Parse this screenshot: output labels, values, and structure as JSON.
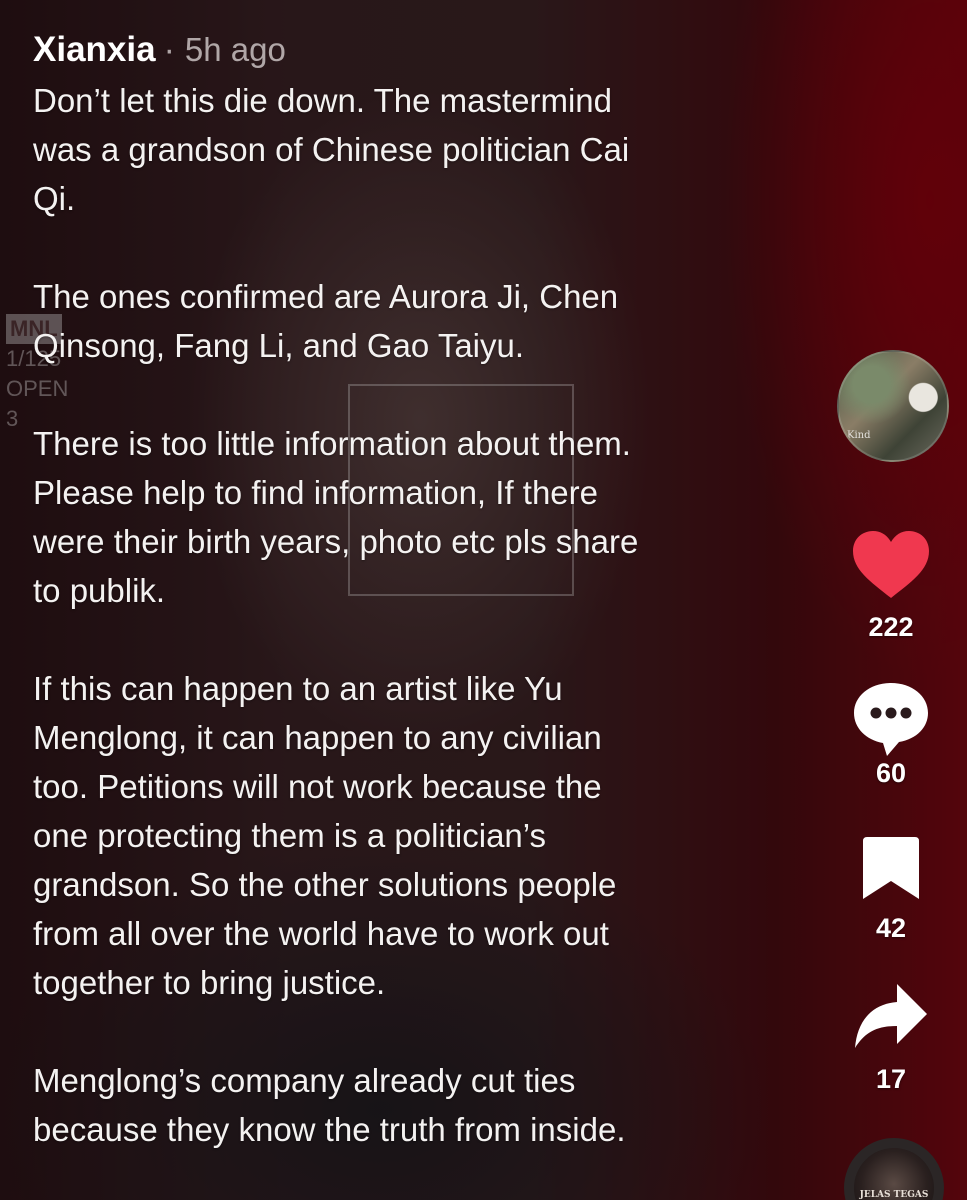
{
  "comment": {
    "username": "Xianxia",
    "separator": "·",
    "time": "5h ago",
    "paragraphs": [
      "Don’t let this die down. The mastermind\nwas a grandson of Chinese politician Cai\nQi.",
      "The ones confirmed are Aurora Ji, Chen\nQinsong, Fang Li, and Gao Taiyu.",
      "There is too little information about them.\nPlease help to find information, If there\nwere their birth years, photo etc pls share\nto publik.",
      "If this can happen to an artist like Yu\nMenglong, it can happen to any civilian\ntoo. Petitions will not work because the\none protecting them is a politician’s\ngrandson. So the other solutions people\nfrom all over the world have to work out\ntogether to bring justice.",
      "Menglong’s company already cut ties\nbecause they know the truth from inside."
    ]
  },
  "background_text": {
    "tag_line1": "MNL",
    "tag_line2": "1/125",
    "tag_line3": "OPEN",
    "tag_line4": "3"
  },
  "rail": {
    "avatar_caption": "Kind",
    "like": {
      "icon": "heart-icon",
      "count": "222",
      "color": "#f0384f"
    },
    "comments": {
      "icon": "comment-bubble-icon",
      "count": "60"
    },
    "bookmarks": {
      "icon": "bookmark-icon",
      "count": "42"
    },
    "shares": {
      "icon": "share-arrow-icon",
      "count": "17"
    }
  },
  "music_disc": {
    "label": "JELAS TEGAS"
  }
}
